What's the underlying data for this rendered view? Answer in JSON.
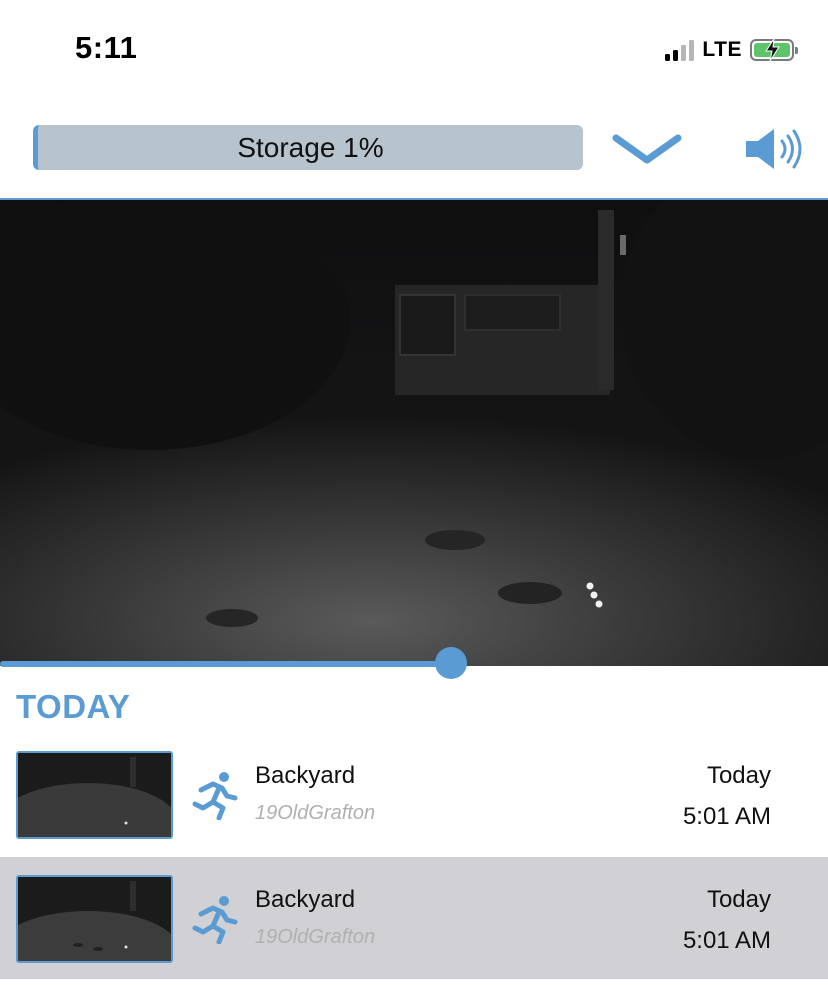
{
  "status_bar": {
    "time": "5:11",
    "network": "LTE",
    "battery_level": 0.9,
    "battery_charging": true
  },
  "toolbar": {
    "storage_label": "Storage 1%",
    "storage_percent": 1,
    "chevron_icon": "chevron-down-icon",
    "speaker_icon": "speaker-icon"
  },
  "player": {
    "progress": 0.545
  },
  "section": {
    "title": "TODAY"
  },
  "events": [
    {
      "title": "Backyard",
      "subtitle": "19OldGrafton",
      "day": "Today",
      "time": "5:01 AM",
      "icon": "motion-run-icon",
      "selected": false
    },
    {
      "title": "Backyard",
      "subtitle": "19OldGrafton",
      "day": "Today",
      "time": "5:01 AM",
      "icon": "motion-run-icon",
      "selected": true
    }
  ],
  "colors": {
    "accent": "#5b9bd3",
    "storage_bg": "#b7c3cd",
    "selected_row": "#d0d0d5",
    "subtitle": "#b0b0b0"
  }
}
